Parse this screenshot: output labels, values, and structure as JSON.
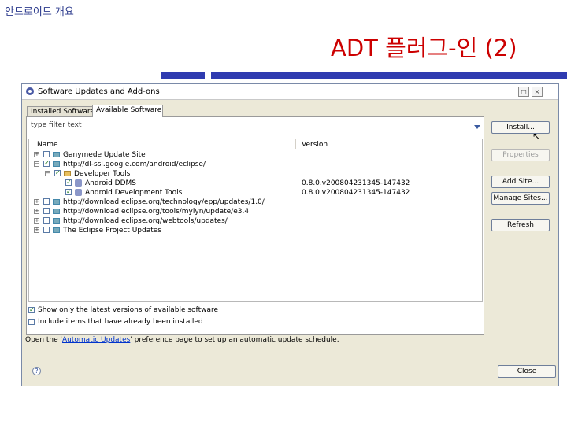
{
  "slide": {
    "course_title": "안드로이드 개요",
    "title": "ADT 플러그-인 (2)"
  },
  "window": {
    "title": "Software Updates and Add-ons",
    "controls": {
      "maximize": "□",
      "close": "×"
    }
  },
  "tabs": [
    {
      "label": "Installed Software",
      "active": false
    },
    {
      "label": "Available Software",
      "active": true
    }
  ],
  "filter": {
    "placeholder": "type filter text"
  },
  "tree": {
    "columns": {
      "name": "Name",
      "version": "Version"
    },
    "rows": [
      {
        "label": "Ganymede Update Site",
        "version": "",
        "expander": "+",
        "checked": false,
        "icon": "site-icon"
      },
      {
        "label": "http://dl-ssl.google.com/android/eclipse/",
        "version": "",
        "expander": "−",
        "checked": true,
        "icon": "site-icon"
      },
      {
        "label": "Developer Tools",
        "version": "",
        "expander": "−",
        "checked": true,
        "icon": "folder-icon"
      },
      {
        "label": "Android DDMS",
        "version": "0.8.0.v200804231345-147432",
        "expander": "",
        "checked": true,
        "icon": "feature-icon"
      },
      {
        "label": "Android Development Tools",
        "version": "0.8.0.v200804231345-147432",
        "expander": "",
        "checked": true,
        "icon": "feature-icon"
      },
      {
        "label": "http://download.eclipse.org/technology/epp/updates/1.0/",
        "version": "",
        "expander": "+",
        "checked": false,
        "icon": "site-icon"
      },
      {
        "label": "http://download.eclipse.org/tools/mylyn/update/e3.4",
        "version": "",
        "expander": "+",
        "checked": false,
        "icon": "site-icon"
      },
      {
        "label": "http://download.eclipse.org/webtools/updates/",
        "version": "",
        "expander": "+",
        "checked": false,
        "icon": "site-icon"
      },
      {
        "label": "The Eclipse Project Updates",
        "version": "",
        "expander": "+",
        "checked": false,
        "icon": "site-icon"
      }
    ]
  },
  "buttons": {
    "install": "Install...",
    "properties": "Properties",
    "add_site": "Add Site...",
    "manage_sites": "Manage Sites...",
    "refresh": "Refresh",
    "close": "Close"
  },
  "options": {
    "latest_only": {
      "label": "Show only the latest versions of available software",
      "checked": true
    },
    "include_installed": {
      "label": "Include items that have already been installed",
      "checked": false
    }
  },
  "preference": {
    "prefix": "Open the '",
    "link": "Automatic Updates",
    "suffix": "' preference page to set up an automatic update schedule."
  }
}
